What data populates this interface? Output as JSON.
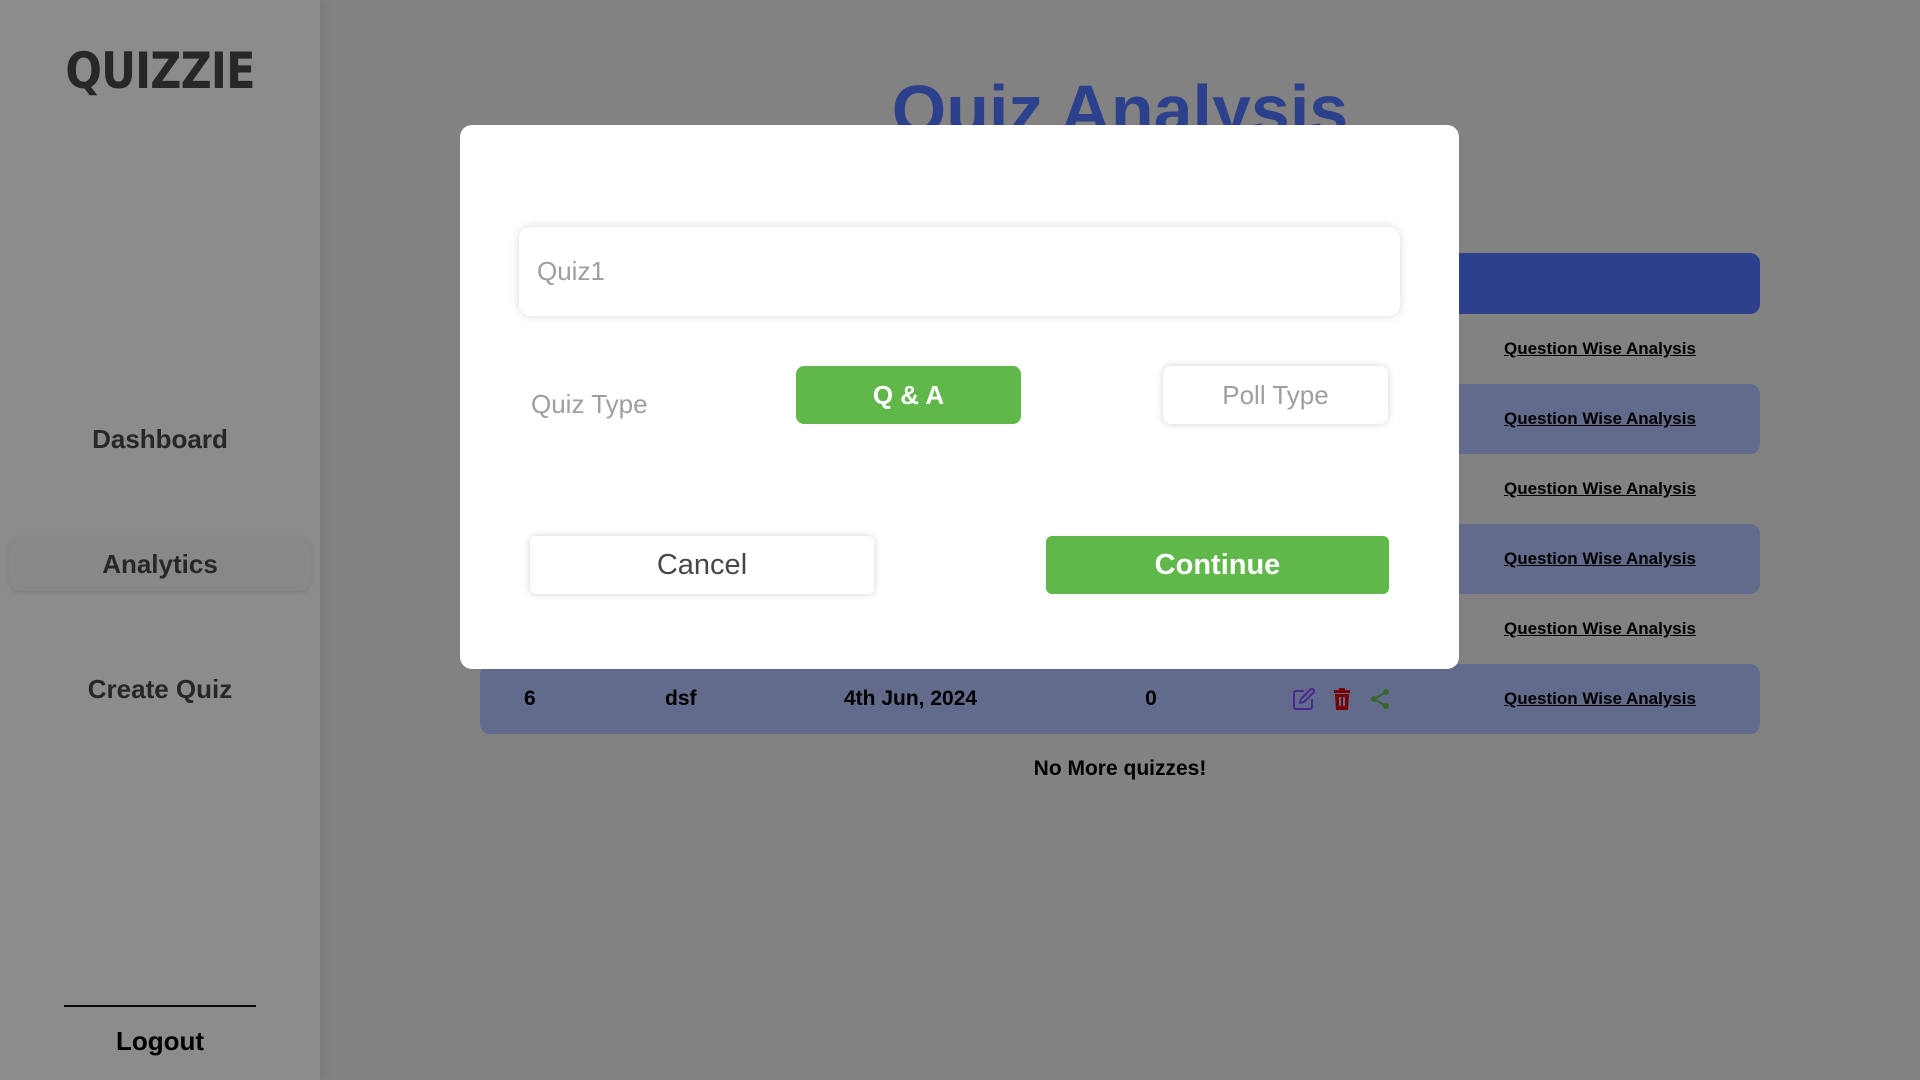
{
  "sidebar": {
    "logo": "QUIZZIE",
    "items": [
      {
        "label": "Dashboard"
      },
      {
        "label": "Analytics"
      },
      {
        "label": "Create Quiz"
      }
    ],
    "logout": "Logout"
  },
  "main": {
    "title": "Quiz Analysis",
    "rows": [
      {
        "link": "Question Wise Analysis"
      },
      {
        "link": "Question Wise Analysis"
      },
      {
        "link": "Question Wise Analysis"
      },
      {
        "link": "Question Wise Analysis"
      },
      {
        "link": "Question Wise Analysis"
      },
      {
        "num": "6",
        "name": "dsf",
        "date": "4th Jun, 2024",
        "impressions": "0",
        "link": "Question Wise Analysis"
      }
    ],
    "no_more": "No More quizzes!"
  },
  "modal": {
    "quiz_name_placeholder": "Quiz1",
    "quiz_type_label": "Quiz Type",
    "qa_label": "Q & A",
    "poll_label": "Poll Type",
    "cancel_label": "Cancel",
    "continue_label": "Continue"
  },
  "icons": {
    "edit": "edit-icon",
    "delete": "trash-icon",
    "share": "share-icon"
  },
  "colors": {
    "accent": "#5076ff",
    "row_tint": "#b3c3ff",
    "green": "#60b84b",
    "edit_icon": "#854cff",
    "delete_icon": "#d60000",
    "share_icon": "#60b84b"
  }
}
